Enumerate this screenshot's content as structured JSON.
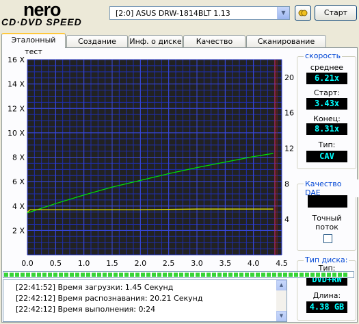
{
  "app": {
    "logo_top": "nero",
    "logo_bottom": "CD·DVD SPEED"
  },
  "toolbar": {
    "drive": "[2:0]   ASUS DRW-1814BLT 1.13",
    "start_label": "Старт",
    "eject_icon": "eject-icon"
  },
  "tabs": [
    {
      "label": "Эталонный тест",
      "active": true
    },
    {
      "label": "Создание диска",
      "active": false
    },
    {
      "label": "Инф. о диске",
      "active": false
    },
    {
      "label": "Качество диска",
      "active": false
    },
    {
      "label": "Сканирование диска",
      "active": false
    }
  ],
  "speed": {
    "title": "скорость",
    "avg_label": "среднее",
    "avg_value": "6.21x",
    "start_label": "Старт:",
    "start_value": "3.43x",
    "end_label": "Конец:",
    "end_value": "8.31x",
    "type_label": "Тип:",
    "type_value": "CAV"
  },
  "dae": {
    "title": "Качество DAE",
    "accurate_label_1": "Точный",
    "accurate_label_2": "поток"
  },
  "disc": {
    "title": "Тип диска:",
    "type_label": "Тип:",
    "type_value": "DVD+RW",
    "length_label": "Длина:",
    "length_value": "4.38 GB"
  },
  "log": [
    {
      "time": "[22:41:52]",
      "text": "Время загрузки: 1.45 Секунд"
    },
    {
      "time": "[22:42:12]",
      "text": "Время распознавания: 20.21 Секунд"
    },
    {
      "time": "[22:42:12]",
      "text": "Время выполнения:  0:24"
    }
  ],
  "progress": 1.0,
  "chart_data": {
    "type": "line",
    "xlim": [
      0,
      4.5
    ],
    "ylim": [
      0,
      16
    ],
    "y2lim": [
      0,
      22
    ],
    "x_ticks": [
      "0.0",
      "0.5",
      "1.0",
      "1.5",
      "2.0",
      "2.5",
      "3.0",
      "3.5",
      "4.0",
      "4.5"
    ],
    "y_ticks": [
      "2 X",
      "4 X",
      "6 X",
      "8 X",
      "10 X",
      "12 X",
      "14 X",
      "16 X"
    ],
    "y2_ticks": [
      "4",
      "8",
      "12",
      "16",
      "20"
    ],
    "grid": true,
    "background": "#222222",
    "grid_color": "#1f2fb0",
    "marker_x": 4.38,
    "series": [
      {
        "color": "#00e000",
        "x": [
          0,
          0.5,
          1.0,
          1.5,
          2.0,
          2.5,
          3.0,
          3.5,
          4.0,
          4.35
        ],
        "values": [
          3.43,
          4.2,
          4.9,
          5.55,
          6.1,
          6.65,
          7.15,
          7.6,
          8.05,
          8.31
        ]
      },
      {
        "color": "#e8e800",
        "x": [
          0,
          0.05,
          1.0,
          2.0,
          3.0,
          4.35
        ],
        "values": [
          3.5,
          3.7,
          3.7,
          3.7,
          3.75,
          3.75
        ]
      }
    ]
  }
}
